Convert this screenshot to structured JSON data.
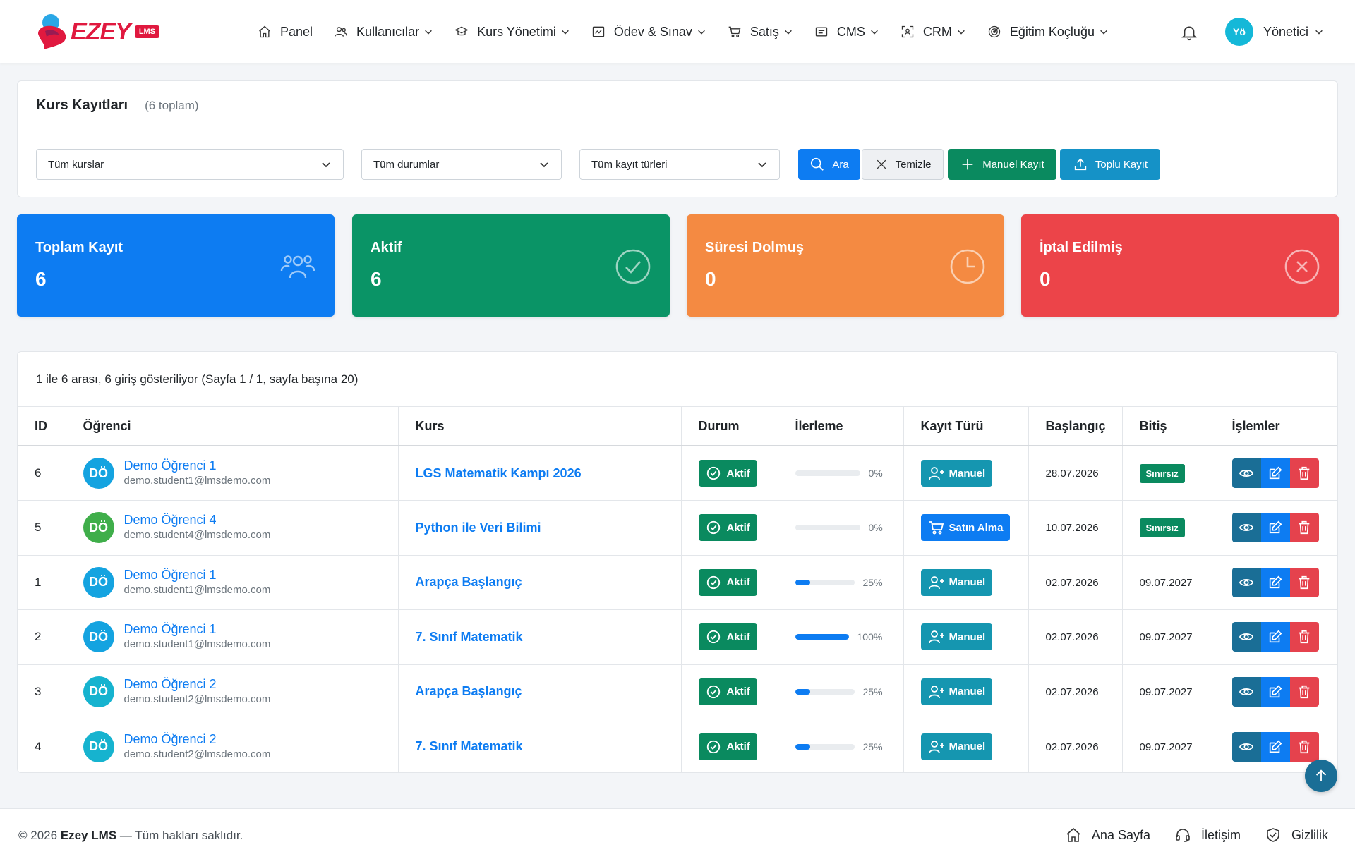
{
  "brand": {
    "name": "EZEY",
    "badge": "LMS"
  },
  "nav": [
    {
      "label": "Panel",
      "icon": "home-icon",
      "dropdown": false
    },
    {
      "label": "Kullanıcılar",
      "icon": "users-icon",
      "dropdown": true
    },
    {
      "label": "Kurs Yönetimi",
      "icon": "graduation-cap-icon",
      "dropdown": true
    },
    {
      "label": "Ödev & Sınav",
      "icon": "clipboard-chart-icon",
      "dropdown": true
    },
    {
      "label": "Satış",
      "icon": "cart-icon",
      "dropdown": true
    },
    {
      "label": "CMS",
      "icon": "cms-list-icon",
      "dropdown": true
    },
    {
      "label": "CRM",
      "icon": "crm-scan-icon",
      "dropdown": true
    },
    {
      "label": "Eğitim Koçluğu",
      "icon": "target-icon",
      "dropdown": true
    }
  ],
  "user": {
    "initials": "Yö",
    "name": "Yönetici"
  },
  "page": {
    "title": "Kurs Kayıtları",
    "count": "(6 toplam)"
  },
  "filters": {
    "course": "Tüm kurslar",
    "status": "Tüm durumlar",
    "type": "Tüm kayıt türleri",
    "search": "Ara",
    "clear": "Temizle",
    "manual": "Manuel Kayıt",
    "bulk": "Toplu Kayıt"
  },
  "stats": [
    {
      "label": "Toplam Kayıt",
      "value": "6",
      "color": "#0d7cf2",
      "icon": "users-icon"
    },
    {
      "label": "Aktif",
      "value": "6",
      "color": "#0a9466",
      "icon": "check-circle-icon"
    },
    {
      "label": "Süresi Dolmuş",
      "value": "0",
      "color": "#f48a42",
      "icon": "clock-icon"
    },
    {
      "label": "İptal Edilmiş",
      "value": "0",
      "color": "#ec4449",
      "icon": "x-circle-icon"
    }
  ],
  "table": {
    "info": "1 ile 6 arası, 6 giriş gösteriliyor (Sayfa 1 / 1, sayfa başına 20)",
    "headers": [
      "ID",
      "Öğrenci",
      "Kurs",
      "Durum",
      "İlerleme",
      "Kayıt Türü",
      "Başlangıç",
      "Bitiş",
      "İşlemler"
    ],
    "rows": [
      {
        "id": "6",
        "initials": "DÖ",
        "avatar_color": "#14a3e0",
        "name": "Demo Öğrenci 1",
        "email": "demo.student1@lmsdemo.com",
        "course": "LGS Matematik Kampı 2026",
        "status": "Aktif",
        "progress": 0,
        "progress_text": "0%",
        "type": "Manuel",
        "type_kind": "manual",
        "start": "28.07.2026",
        "end": "Sınırsız",
        "end_unlimited": true
      },
      {
        "id": "5",
        "initials": "DÖ",
        "avatar_color": "#3fae4a",
        "name": "Demo Öğrenci 4",
        "email": "demo.student4@lmsdemo.com",
        "course": "Python ile Veri Bilimi",
        "status": "Aktif",
        "progress": 0,
        "progress_text": "0%",
        "type": "Satın Alma",
        "type_kind": "buy",
        "start": "10.07.2026",
        "end": "Sınırsız",
        "end_unlimited": true
      },
      {
        "id": "1",
        "initials": "DÖ",
        "avatar_color": "#14a3e0",
        "name": "Demo Öğrenci 1",
        "email": "demo.student1@lmsdemo.com",
        "course": "Arapça Başlangıç",
        "status": "Aktif",
        "progress": 25,
        "progress_text": "25%",
        "type": "Manuel",
        "type_kind": "manual",
        "start": "02.07.2026",
        "end": "09.07.2027",
        "end_unlimited": false
      },
      {
        "id": "2",
        "initials": "DÖ",
        "avatar_color": "#14a3e0",
        "name": "Demo Öğrenci 1",
        "email": "demo.student1@lmsdemo.com",
        "course": "7. Sınıf Matematik",
        "status": "Aktif",
        "progress": 100,
        "progress_text": "100%",
        "type": "Manuel",
        "type_kind": "manual",
        "start": "02.07.2026",
        "end": "09.07.2027",
        "end_unlimited": false
      },
      {
        "id": "3",
        "initials": "DÖ",
        "avatar_color": "#16b3cf",
        "name": "Demo Öğrenci 2",
        "email": "demo.student2@lmsdemo.com",
        "course": "Arapça Başlangıç",
        "status": "Aktif",
        "progress": 25,
        "progress_text": "25%",
        "type": "Manuel",
        "type_kind": "manual",
        "start": "02.07.2026",
        "end": "09.07.2027",
        "end_unlimited": false
      },
      {
        "id": "4",
        "initials": "DÖ",
        "avatar_color": "#16b3cf",
        "name": "Demo Öğrenci 2",
        "email": "demo.student2@lmsdemo.com",
        "course": "7. Sınıf Matematik",
        "status": "Aktif",
        "progress": 25,
        "progress_text": "25%",
        "type": "Manuel",
        "type_kind": "manual",
        "start": "02.07.2026",
        "end": "09.07.2027",
        "end_unlimited": false
      }
    ]
  },
  "footer": {
    "copyright_prefix": "© 2026",
    "brand": "Ezey LMS",
    "copyright_suffix": "— Tüm hakları saklıdır.",
    "links": [
      {
        "label": "Ana Sayfa",
        "icon": "home-icon"
      },
      {
        "label": "İletişim",
        "icon": "headset-icon"
      },
      {
        "label": "Gizlilik",
        "icon": "shield-check-icon"
      }
    ]
  }
}
